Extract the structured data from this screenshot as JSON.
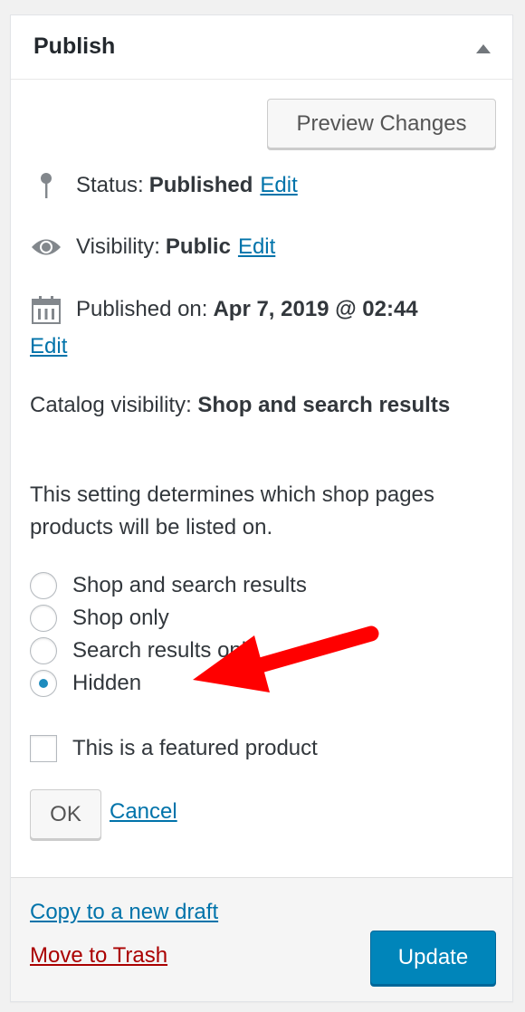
{
  "panel": {
    "title": "Publish",
    "toggle_icon": "triangle-up-icon",
    "preview_button": "Preview Changes",
    "status": {
      "label": "Status:",
      "value": "Published",
      "edit": "Edit",
      "icon": "pin-icon"
    },
    "visibility": {
      "label": "Visibility:",
      "value": "Public",
      "edit": "Edit",
      "icon": "eye-icon"
    },
    "published_on": {
      "label": "Published on:",
      "value": "Apr 7, 2019 @ 02:44",
      "edit": "Edit",
      "icon": "calendar-icon"
    },
    "catalog_visibility": {
      "label": "Catalog visibility:",
      "value": "Shop and search results"
    },
    "description": "This setting determines which shop pages products will be listed on.",
    "radio_options": [
      {
        "label": "Shop and search results",
        "checked": false
      },
      {
        "label": "Shop only",
        "checked": false
      },
      {
        "label": "Search results only",
        "checked": false
      },
      {
        "label": "Hidden",
        "checked": true
      }
    ],
    "featured_checkbox": {
      "label": "This is a featured product",
      "checked": false
    },
    "ok_button": "OK",
    "cancel_link": "Cancel",
    "footer": {
      "copy_link": "Copy to a new draft",
      "trash_link": "Move to Trash",
      "update_button": "Update"
    }
  },
  "colors": {
    "link": "#0073aa",
    "trash": "#aa0000",
    "primary_button": "#0085ba",
    "annotation_arrow": "#ff0000"
  }
}
